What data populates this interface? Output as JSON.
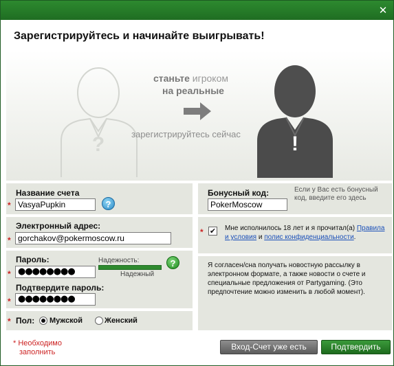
{
  "window": {
    "close_glyph": "✕"
  },
  "heading": "Зарегистрируйтесь и начинайте выигрывать!",
  "hero": {
    "line1_bold": "станьте",
    "line1_light": "игроком",
    "line2": "на реальные",
    "line3": "зарегистрируйтесь сейчас",
    "left_figure_mark": "?",
    "right_figure_mark": "!"
  },
  "account": {
    "label": "Название счета",
    "value": "VasyaPupkin",
    "help_glyph": "?"
  },
  "email": {
    "label": "Электронный адрес:",
    "value": "gorchakov@pokermoscow.ru"
  },
  "password": {
    "label": "Пароль:",
    "value": "●●●●●●●●",
    "strength_label": "Надежность:",
    "strength_value": "Надежный",
    "strength_level": 1.0,
    "help_glyph": "?",
    "confirm_label": "Подтвердите пароль:",
    "confirm_value": "●●●●●●●●"
  },
  "gender": {
    "label": "Пол:",
    "options": [
      "Мужской",
      "Женский"
    ],
    "selected": "Мужской"
  },
  "required_mark": "*",
  "bonus": {
    "label": "Бонусный код:",
    "value": "PokerMoscow",
    "note": "Если у Вас есть бонусный код, введите его здесь"
  },
  "terms": {
    "checked_glyph": "✔",
    "text_before": "Мне исполнилось 18 лет и я прочитал(а)",
    "link1": "Правила и условия",
    "and": "и",
    "link2": "полис конфиденциальности",
    "period": "."
  },
  "newsletter": "Я согласен/сна получать новостную рассылку в электронном формате, а также новости о счете и специальные предложения от Partygaming. (Это предпочтение можно изменить в любой момент).",
  "footnote": {
    "line1": "Необходимо",
    "line2": "заполнить"
  },
  "buttons": {
    "login": "Вход-Счет уже есть",
    "confirm": "Подтвердить"
  },
  "colors": {
    "brand_green": "#1f6d22",
    "panel": "#e4e6df",
    "required": "#cc2222",
    "link": "#1a4fb8"
  }
}
